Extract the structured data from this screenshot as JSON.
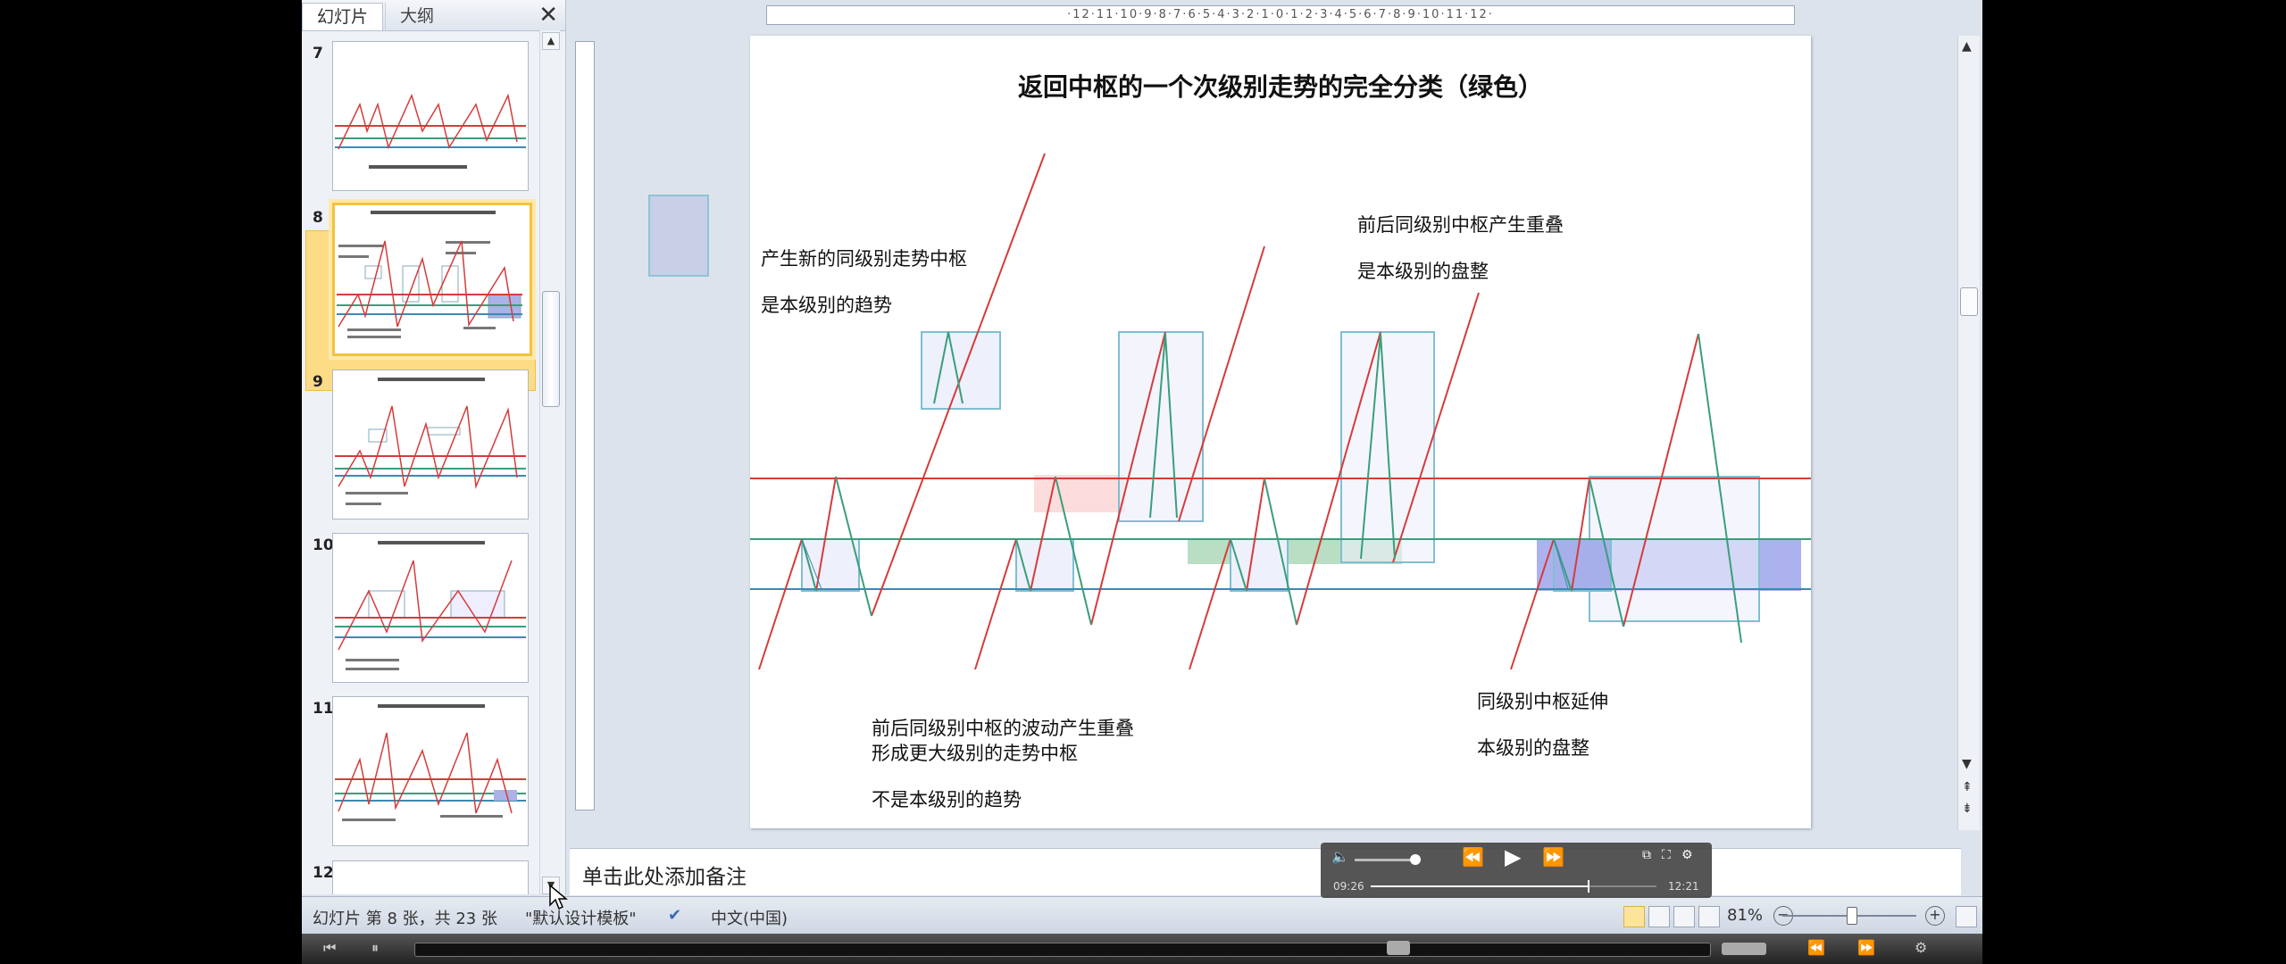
{
  "tabs": {
    "slides": "幻灯片",
    "outline": "大纲",
    "close": "✕"
  },
  "thumbnails": [
    {
      "num": "7"
    },
    {
      "num": "8"
    },
    {
      "num": "9"
    },
    {
      "num": "10"
    },
    {
      "num": "11"
    },
    {
      "num": "12"
    }
  ],
  "ruler": {
    "horizontal": "·12·11·10·9·8·7·6·5·4·3·2·1·0·1·2·3·4·5·6·7·8·9·10·11·12·"
  },
  "slide": {
    "title": "返回中枢的一个次级别走势的完全分类（绿色）",
    "text1a": "产生新的同级别走势中枢",
    "text1b": "是本级别的趋势",
    "text2a": "前后同级别中枢产生重叠",
    "text2b": "是本级别的盘整",
    "text3a": "前后同级别中枢的波动产生重叠",
    "text3b": "形成更大级别的走势中枢",
    "text3c": "不是本级别的趋势",
    "text4a": "同级别中枢延伸",
    "text4b": "本级别的盘整"
  },
  "notes": {
    "placeholder": "单击此处添加备注"
  },
  "status": {
    "slide_info": "幻灯片 第 8 张，共 23 张",
    "theme": "\"默认设计模板\"",
    "language": "中文(中国)",
    "zoom": "81%",
    "zoom_out": "−",
    "zoom_in": "+"
  },
  "player": {
    "current_time": "09:26",
    "total_time": "12:21",
    "progress": 0.76,
    "volume": 0.7
  },
  "colors": {
    "red_line": "#d63b3b",
    "green_line": "#3a9e7c",
    "blue_line": "#3a8ab3",
    "selection": "#f4c23e"
  }
}
